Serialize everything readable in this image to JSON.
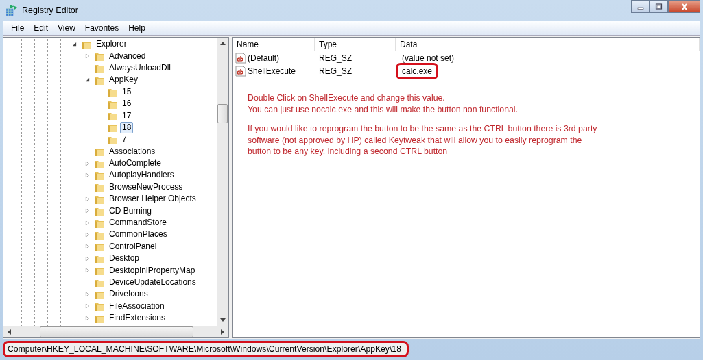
{
  "window": {
    "title": "Registry Editor"
  },
  "menu": [
    "File",
    "Edit",
    "View",
    "Favorites",
    "Help"
  ],
  "tree": [
    {
      "label": "Explorer",
      "expanded": true,
      "selected": false,
      "children": [
        {
          "label": "Advanced",
          "expanded": false,
          "selected": false
        },
        {
          "label": "AlwaysUnloadDll",
          "selected": false
        },
        {
          "label": "AppKey",
          "expanded": true,
          "selected": false,
          "children": [
            {
              "label": "15",
              "selected": false
            },
            {
              "label": "16",
              "selected": false
            },
            {
              "label": "17",
              "selected": false
            },
            {
              "label": "18",
              "selected": true
            },
            {
              "label": "7",
              "selected": false
            }
          ]
        },
        {
          "label": "Associations",
          "selected": false
        },
        {
          "label": "AutoComplete",
          "expanded": false,
          "selected": false
        },
        {
          "label": "AutoplayHandlers",
          "expanded": false,
          "selected": false
        },
        {
          "label": "BrowseNewProcess",
          "selected": false
        },
        {
          "label": "Browser Helper Objects",
          "expanded": false,
          "selected": false
        },
        {
          "label": "CD Burning",
          "expanded": false,
          "selected": false
        },
        {
          "label": "CommandStore",
          "expanded": false,
          "selected": false
        },
        {
          "label": "CommonPlaces",
          "expanded": false,
          "selected": false
        },
        {
          "label": "ControlPanel",
          "expanded": false,
          "selected": false
        },
        {
          "label": "Desktop",
          "expanded": false,
          "selected": false
        },
        {
          "label": "DesktopIniPropertyMap",
          "expanded": false,
          "selected": false
        },
        {
          "label": "DeviceUpdateLocations",
          "selected": false
        },
        {
          "label": "DriveIcons",
          "expanded": false,
          "selected": false
        },
        {
          "label": "FileAssociation",
          "expanded": false,
          "selected": false
        },
        {
          "label": "FindExtensions",
          "expanded": false,
          "selected": false
        }
      ]
    }
  ],
  "table": {
    "columns": [
      "Name",
      "Type",
      "Data"
    ],
    "rows": [
      {
        "name": "(Default)",
        "type": "REG_SZ",
        "data": "(value not set)",
        "highlighted": false
      },
      {
        "name": "ShellExecute",
        "type": "REG_SZ",
        "data": "calc.exe",
        "highlighted": true
      }
    ]
  },
  "annotation": [
    "Double Click on ShellExecute and change this value.\nYou can just use nocalc.exe  and this will make the button non functional.",
    "If you would like to reprogram the button to be the same as the CTRL button there is 3rd party software (not approved by HP) called Keytweak that will allow you to easily reprogram the button to be any key, including a second CTRL button"
  ],
  "status_bar": "Computer\\HKEY_LOCAL_MACHINE\\SOFTWARE\\Microsoft\\Windows\\CurrentVersion\\Explorer\\AppKey\\18"
}
